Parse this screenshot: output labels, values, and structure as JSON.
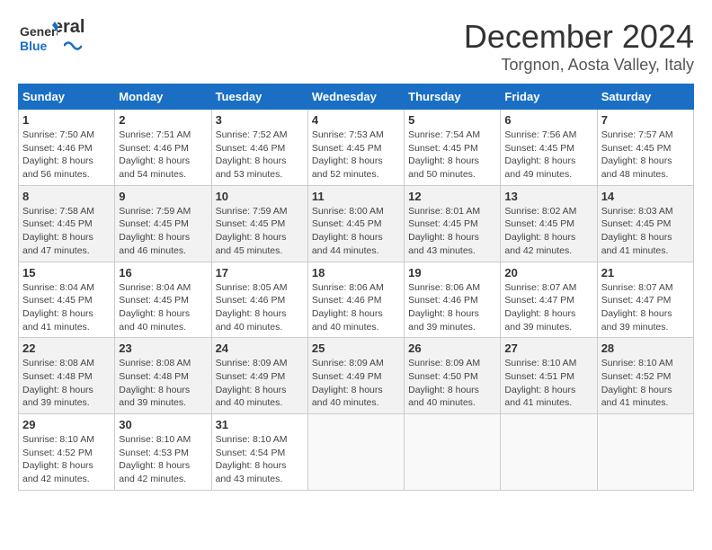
{
  "header": {
    "logo_line1": "General",
    "logo_line2": "Blue",
    "title": "December 2024",
    "subtitle": "Torgnon, Aosta Valley, Italy"
  },
  "weekdays": [
    "Sunday",
    "Monday",
    "Tuesday",
    "Wednesday",
    "Thursday",
    "Friday",
    "Saturday"
  ],
  "weeks": [
    [
      {
        "day": "1",
        "info": "Sunrise: 7:50 AM\nSunset: 4:46 PM\nDaylight: 8 hours\nand 56 minutes."
      },
      {
        "day": "2",
        "info": "Sunrise: 7:51 AM\nSunset: 4:46 PM\nDaylight: 8 hours\nand 54 minutes."
      },
      {
        "day": "3",
        "info": "Sunrise: 7:52 AM\nSunset: 4:46 PM\nDaylight: 8 hours\nand 53 minutes."
      },
      {
        "day": "4",
        "info": "Sunrise: 7:53 AM\nSunset: 4:45 PM\nDaylight: 8 hours\nand 52 minutes."
      },
      {
        "day": "5",
        "info": "Sunrise: 7:54 AM\nSunset: 4:45 PM\nDaylight: 8 hours\nand 50 minutes."
      },
      {
        "day": "6",
        "info": "Sunrise: 7:56 AM\nSunset: 4:45 PM\nDaylight: 8 hours\nand 49 minutes."
      },
      {
        "day": "7",
        "info": "Sunrise: 7:57 AM\nSunset: 4:45 PM\nDaylight: 8 hours\nand 48 minutes."
      }
    ],
    [
      {
        "day": "8",
        "info": "Sunrise: 7:58 AM\nSunset: 4:45 PM\nDaylight: 8 hours\nand 47 minutes."
      },
      {
        "day": "9",
        "info": "Sunrise: 7:59 AM\nSunset: 4:45 PM\nDaylight: 8 hours\nand 46 minutes."
      },
      {
        "day": "10",
        "info": "Sunrise: 7:59 AM\nSunset: 4:45 PM\nDaylight: 8 hours\nand 45 minutes."
      },
      {
        "day": "11",
        "info": "Sunrise: 8:00 AM\nSunset: 4:45 PM\nDaylight: 8 hours\nand 44 minutes."
      },
      {
        "day": "12",
        "info": "Sunrise: 8:01 AM\nSunset: 4:45 PM\nDaylight: 8 hours\nand 43 minutes."
      },
      {
        "day": "13",
        "info": "Sunrise: 8:02 AM\nSunset: 4:45 PM\nDaylight: 8 hours\nand 42 minutes."
      },
      {
        "day": "14",
        "info": "Sunrise: 8:03 AM\nSunset: 4:45 PM\nDaylight: 8 hours\nand 41 minutes."
      }
    ],
    [
      {
        "day": "15",
        "info": "Sunrise: 8:04 AM\nSunset: 4:45 PM\nDaylight: 8 hours\nand 41 minutes."
      },
      {
        "day": "16",
        "info": "Sunrise: 8:04 AM\nSunset: 4:45 PM\nDaylight: 8 hours\nand 40 minutes."
      },
      {
        "day": "17",
        "info": "Sunrise: 8:05 AM\nSunset: 4:46 PM\nDaylight: 8 hours\nand 40 minutes."
      },
      {
        "day": "18",
        "info": "Sunrise: 8:06 AM\nSunset: 4:46 PM\nDaylight: 8 hours\nand 40 minutes."
      },
      {
        "day": "19",
        "info": "Sunrise: 8:06 AM\nSunset: 4:46 PM\nDaylight: 8 hours\nand 39 minutes."
      },
      {
        "day": "20",
        "info": "Sunrise: 8:07 AM\nSunset: 4:47 PM\nDaylight: 8 hours\nand 39 minutes."
      },
      {
        "day": "21",
        "info": "Sunrise: 8:07 AM\nSunset: 4:47 PM\nDaylight: 8 hours\nand 39 minutes."
      }
    ],
    [
      {
        "day": "22",
        "info": "Sunrise: 8:08 AM\nSunset: 4:48 PM\nDaylight: 8 hours\nand 39 minutes."
      },
      {
        "day": "23",
        "info": "Sunrise: 8:08 AM\nSunset: 4:48 PM\nDaylight: 8 hours\nand 39 minutes."
      },
      {
        "day": "24",
        "info": "Sunrise: 8:09 AM\nSunset: 4:49 PM\nDaylight: 8 hours\nand 40 minutes."
      },
      {
        "day": "25",
        "info": "Sunrise: 8:09 AM\nSunset: 4:49 PM\nDaylight: 8 hours\nand 40 minutes."
      },
      {
        "day": "26",
        "info": "Sunrise: 8:09 AM\nSunset: 4:50 PM\nDaylight: 8 hours\nand 40 minutes."
      },
      {
        "day": "27",
        "info": "Sunrise: 8:10 AM\nSunset: 4:51 PM\nDaylight: 8 hours\nand 41 minutes."
      },
      {
        "day": "28",
        "info": "Sunrise: 8:10 AM\nSunset: 4:52 PM\nDaylight: 8 hours\nand 41 minutes."
      }
    ],
    [
      {
        "day": "29",
        "info": "Sunrise: 8:10 AM\nSunset: 4:52 PM\nDaylight: 8 hours\nand 42 minutes."
      },
      {
        "day": "30",
        "info": "Sunrise: 8:10 AM\nSunset: 4:53 PM\nDaylight: 8 hours\nand 42 minutes."
      },
      {
        "day": "31",
        "info": "Sunrise: 8:10 AM\nSunset: 4:54 PM\nDaylight: 8 hours\nand 43 minutes."
      },
      null,
      null,
      null,
      null
    ]
  ]
}
